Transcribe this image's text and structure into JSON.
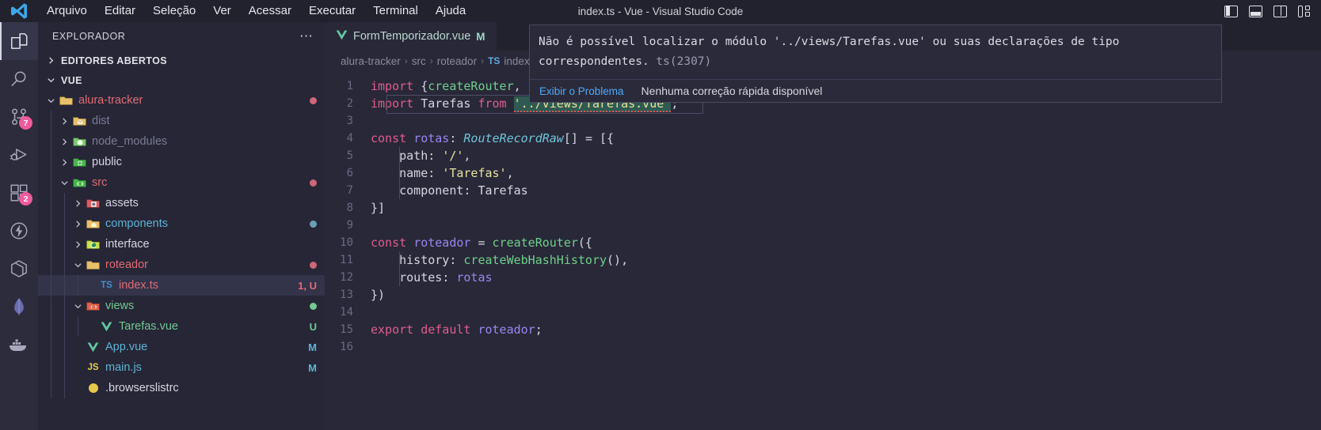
{
  "window": {
    "title": "index.ts - Vue - Visual Studio Code"
  },
  "menubar": {
    "items": [
      {
        "label": "Arquivo"
      },
      {
        "label": "Editar"
      },
      {
        "label": "Seleção"
      },
      {
        "label": "Ver"
      },
      {
        "label": "Acessar"
      },
      {
        "label": "Executar"
      },
      {
        "label": "Terminal"
      },
      {
        "label": "Ajuda"
      }
    ]
  },
  "layout_controls": [
    {
      "name": "toggle-primary-sidebar",
      "icon": "panel-left-icon"
    },
    {
      "name": "toggle-panel",
      "icon": "panel-bottom-icon"
    },
    {
      "name": "toggle-secondary-sidebar",
      "icon": "panel-right-icon"
    },
    {
      "name": "customize-layout",
      "icon": "layout-grid-icon"
    }
  ],
  "activitybar": {
    "items": [
      {
        "name": "explorer",
        "icon": "files-icon",
        "active": true,
        "badge": ""
      },
      {
        "name": "search",
        "icon": "search-icon",
        "active": false,
        "badge": ""
      },
      {
        "name": "source-control",
        "icon": "source-control-icon",
        "active": false,
        "badge": "7"
      },
      {
        "name": "run-and-debug",
        "icon": "debug-icon",
        "active": false,
        "badge": ""
      },
      {
        "name": "extensions",
        "icon": "extensions-icon",
        "active": false,
        "badge": "2"
      },
      {
        "name": "thunder-client",
        "icon": "thunder-icon",
        "active": false,
        "badge": ""
      },
      {
        "name": "remote-explorer",
        "icon": "hexagon-icon",
        "active": false,
        "badge": ""
      },
      {
        "name": "mongodb",
        "icon": "leaf-icon",
        "active": false,
        "badge": ""
      },
      {
        "name": "docker",
        "icon": "whale-icon",
        "active": false,
        "badge": ""
      }
    ]
  },
  "sidebar": {
    "header": "EXPLORADOR",
    "more_actions": "⋯",
    "sections": [
      {
        "label": "EDITORES ABERTOS",
        "expanded": false
      },
      {
        "label": "VUE",
        "expanded": true
      }
    ],
    "tree": [
      {
        "name": "alura-tracker",
        "indent": 1,
        "type": "folder",
        "expanded": true,
        "icon": "folder-root-icon",
        "color": "#e06c75",
        "deco": "",
        "dot": "#cf6679"
      },
      {
        "name": "dist",
        "indent": 2,
        "type": "folder",
        "expanded": false,
        "icon": "folder-dist-icon",
        "color": "#7b7b95",
        "deco": "",
        "dot": ""
      },
      {
        "name": "node_modules",
        "indent": 2,
        "type": "folder",
        "expanded": false,
        "icon": "folder-node-icon",
        "color": "#7b7b95",
        "deco": "",
        "dot": ""
      },
      {
        "name": "public",
        "indent": 2,
        "type": "folder",
        "expanded": false,
        "icon": "folder-public-icon",
        "color": "#d6d6e2",
        "deco": "",
        "dot": ""
      },
      {
        "name": "src",
        "indent": 2,
        "type": "folder",
        "expanded": true,
        "icon": "folder-src-icon",
        "color": "#e06c75",
        "deco": "",
        "dot": "#cf6679"
      },
      {
        "name": "assets",
        "indent": 3,
        "type": "folder",
        "expanded": false,
        "icon": "folder-assets-icon",
        "color": "#d6d6e2",
        "deco": "",
        "dot": ""
      },
      {
        "name": "components",
        "indent": 3,
        "type": "folder",
        "expanded": false,
        "icon": "folder-components-icon",
        "color": "#5fb3d4",
        "deco": "",
        "dot": "#6b9fb8"
      },
      {
        "name": "interface",
        "indent": 3,
        "type": "folder",
        "expanded": false,
        "icon": "folder-interface-icon",
        "color": "#d6d6e2",
        "deco": "",
        "dot": ""
      },
      {
        "name": "roteador",
        "indent": 3,
        "type": "folder",
        "expanded": true,
        "icon": "folder-router-icon",
        "color": "#e06c75",
        "deco": "",
        "dot": "#cf6679"
      },
      {
        "name": "index.ts",
        "indent": 4,
        "type": "file",
        "expanded": null,
        "icon": "typescript-icon",
        "color": "#e06c75",
        "deco": "1, U",
        "decoColor": "#e06c75",
        "dot": "",
        "selected": true
      },
      {
        "name": "views",
        "indent": 3,
        "type": "folder",
        "expanded": true,
        "icon": "folder-views-icon",
        "color": "#73c991",
        "deco": "",
        "dot": "#73c991"
      },
      {
        "name": "Tarefas.vue",
        "indent": 4,
        "type": "file",
        "expanded": null,
        "icon": "vue-icon",
        "color": "#73c991",
        "deco": "U",
        "decoColor": "#73c991",
        "dot": ""
      },
      {
        "name": "App.vue",
        "indent": 3,
        "type": "file",
        "expanded": null,
        "icon": "vue-icon",
        "color": "#5fb3d4",
        "deco": "M",
        "decoColor": "#5fb3d4",
        "dot": ""
      },
      {
        "name": "main.js",
        "indent": 3,
        "type": "file",
        "expanded": null,
        "icon": "javascript-icon",
        "color": "#5fb3d4",
        "deco": "M",
        "decoColor": "#5fb3d4",
        "dot": ""
      },
      {
        "name": ".browserslistrc",
        "indent": 3,
        "type": "file",
        "expanded": null,
        "icon": "browserslist-icon",
        "color": "#d6d6e2",
        "deco": "",
        "dot": ""
      }
    ]
  },
  "editor": {
    "tabs": [
      {
        "label": "FormTemporizador.vue",
        "badge": "M",
        "icon": "vue-icon",
        "active": true
      }
    ],
    "breadcrumbs": [
      {
        "label": "alura-tracker"
      },
      {
        "label": "src"
      },
      {
        "label": "roteador"
      },
      {
        "label": "TS",
        "is_icon": true
      },
      {
        "label": "index.ts"
      }
    ],
    "lines": [
      {
        "n": "1",
        "text": "import {createRouter, createWebHashHistory, RouteRecordRaw} from 'vue-router';"
      },
      {
        "n": "2",
        "text": "import Tarefas from '../views/Tarefas.vue';"
      },
      {
        "n": "3",
        "text": ""
      },
      {
        "n": "4",
        "text": "const rotas: RouteRecordRaw[] = [{"
      },
      {
        "n": "5",
        "text": "    path: '/',"
      },
      {
        "n": "6",
        "text": "    name: 'Tarefas',"
      },
      {
        "n": "7",
        "text": "    component: Tarefas"
      },
      {
        "n": "8",
        "text": "}]"
      },
      {
        "n": "9",
        "text": ""
      },
      {
        "n": "10",
        "text": "const roteador = createRouter({"
      },
      {
        "n": "11",
        "text": "    history: createWebHashHistory(),"
      },
      {
        "n": "12",
        "text": "    routes: rotas"
      },
      {
        "n": "13",
        "text": "})"
      },
      {
        "n": "14",
        "text": ""
      },
      {
        "n": "15",
        "text": "export default roteador;"
      },
      {
        "n": "16",
        "text": ""
      }
    ]
  },
  "hover": {
    "message": "Não é possível localizar o módulo '../views/Tarefas.vue' ou suas declarações de tipo correspondentes.",
    "code": "ts(2307)",
    "link": "Exibir o Problema",
    "note": "Nenhuma correção rápida disponível"
  },
  "colors": {
    "accent": "#4daafc",
    "error": "#e05555",
    "modified": "#5fb3d4",
    "untracked": "#73c991",
    "badge": "#ef5b9c"
  }
}
